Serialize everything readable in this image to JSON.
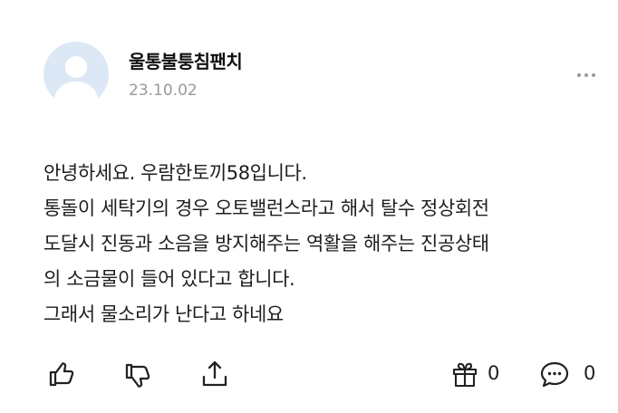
{
  "post": {
    "author": "울통불퉁침팬치",
    "date": "23.10.02",
    "lines": [
      "안녕하세요. 우람한토끼58입니다.",
      "통돌이 세탁기의 경우 오토밸런스라고 해서 탈수 정상회전",
      "도달시 진동과 소음을 방지해주는 역활을 해주는 진공상태",
      "의 소금물이 들어 있다고 합니다.",
      "그래서 물소리가 난다고 하네요"
    ]
  },
  "actions": {
    "gift_count": "0",
    "comment_count": "0"
  },
  "icons": [
    "avatar-placeholder",
    "more-icon",
    "thumbs-up-icon",
    "thumbs-down-icon",
    "share-icon",
    "gift-icon",
    "comment-icon"
  ]
}
